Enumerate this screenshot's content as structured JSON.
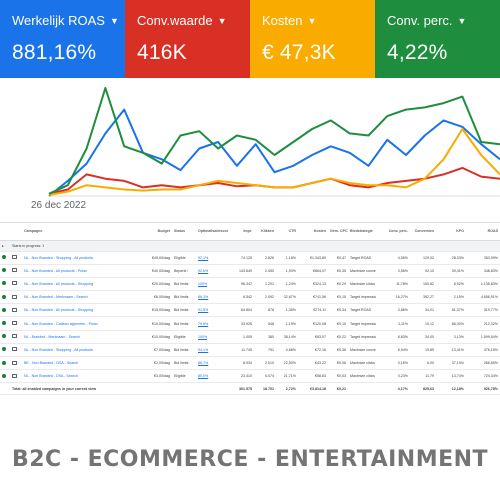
{
  "kpis": [
    {
      "label": "Werkelijk ROAS",
      "value": "881,16%",
      "color": "#1a73e8"
    },
    {
      "label": "Conv.waarde",
      "value": "416K",
      "color": "#d93025"
    },
    {
      "label": "Kosten",
      "value": "€ 47,3K",
      "color": "#f9ab00"
    },
    {
      "label": "Conv. perc.",
      "value": "4,22%",
      "color": "#1e8e3e"
    }
  ],
  "chart": {
    "start_label": "26 dec 2022",
    "series_colors": [
      "#1a73e8",
      "#d93025",
      "#f9ab00",
      "#1e8e3e"
    ]
  },
  "chart_data": {
    "type": "line",
    "x_label_start": "26 dec 2022",
    "series": [
      {
        "color": "#1a73e8",
        "values": [
          0,
          14,
          30,
          58,
          80,
          40,
          34,
          24,
          44,
          50,
          28,
          48,
          22,
          28,
          38,
          46,
          40,
          28,
          52,
          38,
          56,
          70,
          64,
          48,
          34
        ]
      },
      {
        "color": "#d93025",
        "values": [
          2,
          6,
          20,
          16,
          14,
          8,
          10,
          8,
          10,
          12,
          9,
          10,
          8,
          8,
          12,
          16,
          10,
          8,
          12,
          14,
          16,
          20,
          26,
          18,
          16
        ]
      },
      {
        "color": "#f9ab00",
        "values": [
          1,
          4,
          10,
          8,
          6,
          5,
          6,
          6,
          10,
          14,
          12,
          10,
          8,
          8,
          12,
          16,
          12,
          10,
          10,
          8,
          16,
          34,
          62,
          38,
          20
        ]
      },
      {
        "color": "#1e8e3e",
        "values": [
          2,
          10,
          44,
          100,
          46,
          40,
          30,
          56,
          60,
          44,
          56,
          52,
          38,
          50,
          62,
          70,
          58,
          56,
          74,
          80,
          82,
          86,
          92,
          50,
          48
        ]
      }
    ]
  },
  "table": {
    "headers": [
      "Campagne",
      "Budget",
      "Status",
      "Optimalisatiescore",
      "Impr.",
      "Klikken",
      "CTR",
      "Kosten",
      "Gem. CPC",
      "Biedstrategie",
      "Conv. perc.",
      "Conversies",
      "KPO",
      "ROAS"
    ],
    "group_label": "Starts in progress: 1",
    "rows": [
      {
        "name": "NL - Non Branded - Shopping - All products",
        "budget": "€40,00/dag",
        "status": "Eligible",
        "status_alert": "",
        "opt": "92,1%",
        "impr": "74.125",
        "clicks": "2.826",
        "ctr": "1,18%",
        "cost": "€1.343,89",
        "cpc": "€0,47",
        "bid": "Target ROAS",
        "conv_rate": "4,56%",
        "conv": "129,02",
        "cpa": "28,03%",
        "roas": "353,99%"
      },
      {
        "name": "NL - Non Branded - All products - Pmax",
        "budget": "€40,00/dag",
        "status": "Beperkt",
        "status_alert": "!",
        "opt": "92,6%",
        "impr": "143.649",
        "clicks": "2.450",
        "ctr": "1,93%",
        "cost": "€864,07",
        "cpc": "€0,35",
        "bid": "Maximize conversion value (Target ROAS)",
        "conv_rate": "3,56%",
        "conv": "92,10",
        "cpa": "39,41%",
        "roas": "348,83%"
      },
      {
        "name": "NL - Non Branded - All products - Shopping",
        "budget": "€20,00/dag",
        "status": "Bid limits",
        "status_alert": "",
        "opt": "100%",
        "impr": "96.347",
        "clicks": "1.201",
        "ctr": "1,24%",
        "cost": "€324,13",
        "cpc": "€0,29",
        "bid": "Maximize clicks",
        "conv_rate": "11,78%",
        "conv": "150,82",
        "cpa": "8,92%",
        "roas": "1.135,83%"
      },
      {
        "name": "NL - Non Branded - Merknaam - Search",
        "budget": "€6,00/dag",
        "status": "Bid limits",
        "status_alert": "",
        "opt": "86,3%",
        "impr": "6.542",
        "clicks": "2.092",
        "ctr": "32,67%",
        "cost": "€741,56",
        "cpc": "€0,15",
        "bid": "Target impression share",
        "conv_rate": "16,27%",
        "conv": "382,27",
        "cpa": "2,15%",
        "roas": "4.656,91%"
      },
      {
        "name": "NL - Non Branded - All products - Shopping",
        "budget": "€15,00/dag",
        "status": "Bid limits",
        "status_alert": "",
        "opt": "91,5%",
        "impr": "64.804",
        "clicks": "878",
        "ctr": "1,35%",
        "cost": "€274,11",
        "cpc": "€0,34",
        "bid": "Target ROAS",
        "conv_rate": "3,86%",
        "conv": "34,01",
        "cpa": "81,37%",
        "roas": "319,77%"
      },
      {
        "name": "NL - Non Branded - Cadeau algemeen - Pmax",
        "budget": "€10,00/dag",
        "status": "Bid limits",
        "status_alert": "",
        "opt": "79,6%",
        "impr": "33.926",
        "clicks": "548",
        "ctr": "1,19%",
        "cost": "€120,08",
        "cpc": "€0,19",
        "bid": "Target impression share",
        "conv_rate": "1,11%",
        "conv": "10,12",
        "cpa": "86,00%",
        "roas": "212,32%"
      },
      {
        "name": "NL - Branded - Merknaam - Search",
        "budget": "€10,00/dag",
        "status": "Eligible",
        "status_alert": "",
        "opt": "100%",
        "impr": "1.009",
        "clicks": "380",
        "ctr": "38,14%",
        "cost": "€83,07",
        "cpc": "€0,22",
        "bid": "Target impression share",
        "conv_rate": "8,83%",
        "conv": "34,00",
        "cpa": "3,13%",
        "roas": "1.599,54%"
      },
      {
        "name": "NL - Non Branded - Shopping - All products",
        "budget": "€7,00/dag",
        "status": "Bid limits",
        "status_alert": "",
        "opt": "94,1%",
        "impr": "11.745",
        "clicks": "791",
        "ctr": "0,68%",
        "cost": "€72,16",
        "cpc": "€0,36",
        "bid": "Maximize conversion value",
        "conv_rate": "8,94%",
        "conv": "10,89",
        "cpa": "13,41%",
        "roas": "376,15%"
      },
      {
        "name": "BE - Non Branded - DSA - Search",
        "budget": "€2,00/dag",
        "status": "Bid limits",
        "status_alert": "",
        "opt": "88,7%",
        "impr": "8.934",
        "clicks": "2.010",
        "ctr": "22,50%",
        "cost": "€43,22",
        "cpc": "€0,06",
        "bid": "Maximize clicks",
        "conv_rate": "0,16%",
        "conv": "6,00",
        "cpa": "37,19%",
        "roas": "266,65%"
      },
      {
        "name": "NL - Non Branded - DSA - Search",
        "budget": "€3,00/dag",
        "status": "Eligible",
        "status_alert": "",
        "opt": "85,0%",
        "impr": "23.410",
        "clicks": "5.074",
        "ctr": "21,71%",
        "cost": "€58,83",
        "cpc": "€0,03",
        "bid": "Maximize clicks",
        "conv_rate": "0,23%",
        "conv": "11,79",
        "cpa": "13,74%",
        "roas": "724,34%"
      }
    ],
    "total": {
      "label": "Total: all enabled campaigns in your current view",
      "impr": "361.575",
      "clicks": "18.701",
      "ctr": "2,72%",
      "cost": "€3.814,18",
      "cpc": "€0,21",
      "conv_rate": "4,17%",
      "conv": "825,63",
      "cpa": "12,18%",
      "roas": "926,78%"
    }
  },
  "footer": {
    "text": "B2C - ECOMMERCE - ENTERTAINMENT"
  }
}
